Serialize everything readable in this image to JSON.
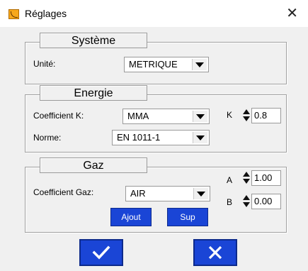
{
  "window": {
    "title": "Réglages",
    "close_glyph": "✕"
  },
  "systeme": {
    "legend": "Système",
    "unite_label": "Unité:",
    "unite_value": "METRIQUE"
  },
  "energie": {
    "legend": "Energie",
    "coef_label": "Coefficient K:",
    "coef_value": "MMA",
    "norme_label": "Norme:",
    "norme_value": "EN 1011-1",
    "k_label": "K",
    "k_value": "0.8"
  },
  "gaz": {
    "legend": "Gaz",
    "coef_label": "Coefficient Gaz:",
    "coef_value": "AIR",
    "a_label": "A",
    "a_value": "1.00",
    "b_label": "B",
    "b_value": "0.00",
    "ajout_label": "Ajout",
    "sup_label": "Sup"
  },
  "icons": {
    "app": "settings-app-icon",
    "ok": "checkmark-icon",
    "cancel": "close-icon"
  },
  "colors": {
    "button_blue": "#1a45d6",
    "icon_orange": "#f7a81b"
  }
}
